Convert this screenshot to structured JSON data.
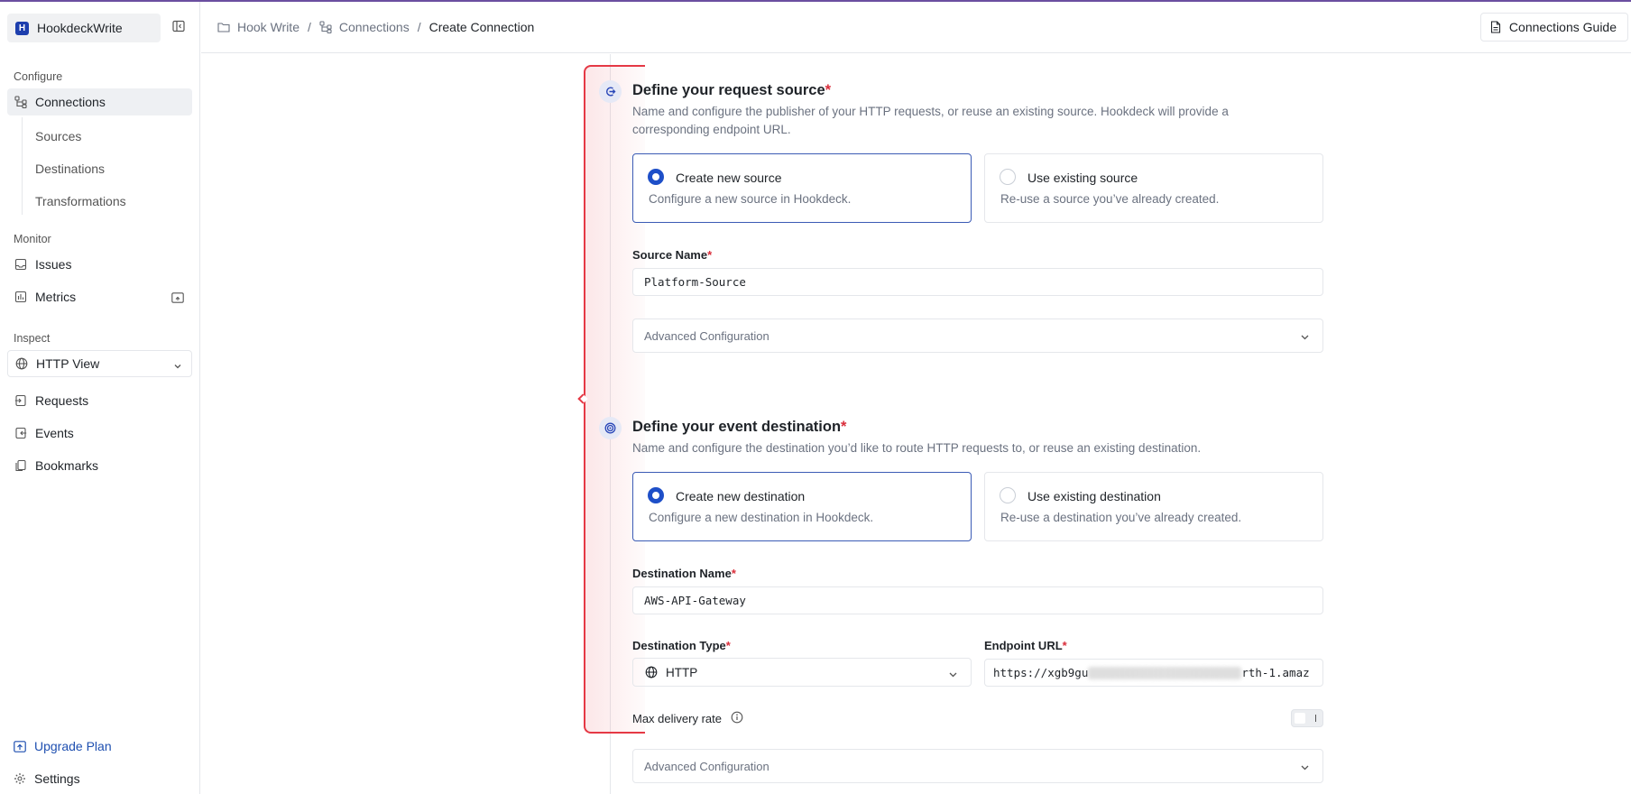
{
  "workspace": {
    "badge": "H",
    "name": "HookdeckWrite"
  },
  "sidebar": {
    "configure_label": "Configure",
    "connections": "Connections",
    "sources": "Sources",
    "destinations": "Destinations",
    "transformations": "Transformations",
    "monitor_label": "Monitor",
    "issues": "Issues",
    "metrics": "Metrics",
    "inspect_label": "Inspect",
    "http_view": "HTTP View",
    "requests": "Requests",
    "events": "Events",
    "bookmarks": "Bookmarks",
    "upgrade": "Upgrade Plan",
    "settings": "Settings"
  },
  "breadcrumb": {
    "items": [
      "Hook Write",
      "Connections",
      "Create Connection"
    ],
    "separator": "/"
  },
  "header": {
    "guide": "Connections Guide"
  },
  "source": {
    "title": "Define your request source",
    "required": "*",
    "description": "Name and configure the publisher of your HTTP requests, or reuse an existing source. Hookdeck will provide a corresponding endpoint URL.",
    "option_new_title": "Create new source",
    "option_new_desc": "Configure a new source in Hookdeck.",
    "option_existing_title": "Use existing source",
    "option_existing_desc": "Re-use a source you’ve already created.",
    "name_label": "Source Name",
    "name_value": "Platform-Source",
    "advanced": "Advanced Configuration"
  },
  "destination": {
    "title": "Define your event destination",
    "required": "*",
    "description": "Name and configure the destination you’d like to route HTTP requests to, or reuse an existing destination.",
    "option_new_title": "Create new destination",
    "option_new_desc": "Configure a new destination in Hookdeck.",
    "option_existing_title": "Use existing destination",
    "option_existing_desc": "Re-use a destination you’ve already created.",
    "name_label": "Destination Name",
    "name_value": "AWS-API-Gateway",
    "type_label": "Destination Type",
    "type_value": "HTTP",
    "url_label": "Endpoint URL",
    "url_prefix": "https://xgb9gu",
    "url_suffix": "rth-1.amaz",
    "rate_label": "Max delivery rate",
    "advanced": "Advanced Configuration"
  },
  "colors": {
    "accent": "#1e4fc8",
    "required": "#d92d3a",
    "highlight": "#e53945"
  },
  "icons": [
    "collapse-sidebar-icon",
    "connections-icon",
    "issues-icon",
    "metrics-icon",
    "globe-icon",
    "requests-icon",
    "events-icon",
    "bookmarks-icon",
    "upgrade-icon",
    "gear-icon",
    "folder-icon",
    "document-icon",
    "source-icon",
    "destination-icon",
    "chevron-down-icon",
    "info-icon"
  ]
}
